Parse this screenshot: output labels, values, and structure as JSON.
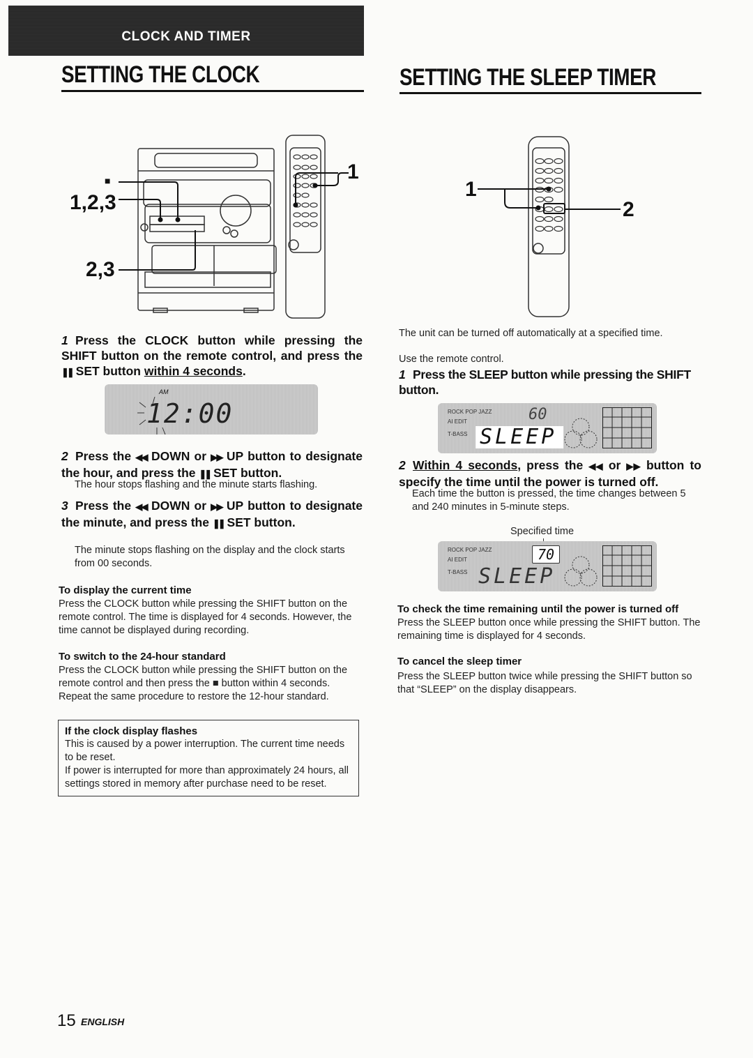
{
  "banner": {
    "label": "CLOCK AND TIMER"
  },
  "clock": {
    "heading": "SETTING THE CLOCK",
    "illustration": {
      "callouts": [
        "■",
        "1,2,3",
        "2,3",
        "1"
      ]
    },
    "steps": [
      {
        "num": "1",
        "title_parts": [
          "Press the CLOCK button while pressing the SHIFT button on the remote control, and press the ",
          "❚❚",
          " SET button ",
          "within 4 seconds",
          "."
        ],
        "body": ""
      },
      {
        "num": "2",
        "title_parts": [
          "Press the ",
          "◀◀",
          " DOWN or ",
          "▶▶",
          " UP button to designate the hour, and press the ",
          "❚❚",
          " SET button."
        ],
        "body": "The hour stops flashing and the minute starts flashing."
      },
      {
        "num": "3",
        "title_parts": [
          "Press the ",
          "◀◀",
          " DOWN or ",
          "▶▶",
          " UP button to designate the minute, and press the ",
          "❚❚",
          " SET button."
        ],
        "body": "The minute stops flashing on the display and the clock starts from 00 seconds."
      }
    ],
    "display1": {
      "indicator": "AM",
      "time": "12:00"
    },
    "notes": [
      {
        "title": "To display the current time",
        "text": "Press the CLOCK button while pressing the SHIFT button on the remote control.  The time is displayed for 4 seconds. However, the time cannot be displayed during recording."
      },
      {
        "title": "To switch to the 24-hour standard",
        "text_parts": [
          "Press the CLOCK button while pressing the SHIFT button on the remote control and then press the ",
          "■",
          " button within 4 seconds. Repeat the same procedure to restore the 12-hour standard."
        ]
      }
    ],
    "infobox": {
      "title": "If the clock display flashes",
      "lines": [
        "This is caused by a power interruption. The current time needs to be reset.",
        "If power is interrupted for more than approximately 24 hours, all settings stored in memory after purchase need to be reset."
      ]
    }
  },
  "sleep": {
    "heading": "SETTING THE SLEEP TIMER",
    "illustration": {
      "callouts": [
        "1",
        "2"
      ]
    },
    "intro": "The unit can be turned off automatically at a specified time.",
    "use_remote": "Use the remote control.",
    "steps": [
      {
        "num": "1",
        "title": "Press the SLEEP button while pressing the SHIFT button."
      },
      {
        "num": "2",
        "title_parts": [
          "Within 4 seconds",
          ", press the ",
          "◀◀",
          " or ",
          "▶▶",
          " button to specify the time until the power is turned off."
        ],
        "body": "Each time the button is pressed, the time changes between 5 and 240 minutes in 5-minute steps."
      }
    ],
    "display_labels": [
      "ROCK  POP  JAZZ",
      "AI EDIT",
      "T-BASS"
    ],
    "display1": {
      "value": "60",
      "word": "SLEEP"
    },
    "display2": {
      "caption": "Specified time",
      "value": "70",
      "word": "SLEEP"
    },
    "notes": [
      {
        "title": "To check the time remaining until the power is turned off",
        "text": "Press the SLEEP button once while pressing the SHIFT button. The remaining time is displayed for 4 seconds."
      },
      {
        "title": "To cancel the sleep timer",
        "text": "Press the SLEEP button twice while pressing the SHIFT button so that “SLEEP” on the display disappears."
      }
    ]
  },
  "footer": {
    "page": "15",
    "language": "ENGLISH"
  }
}
